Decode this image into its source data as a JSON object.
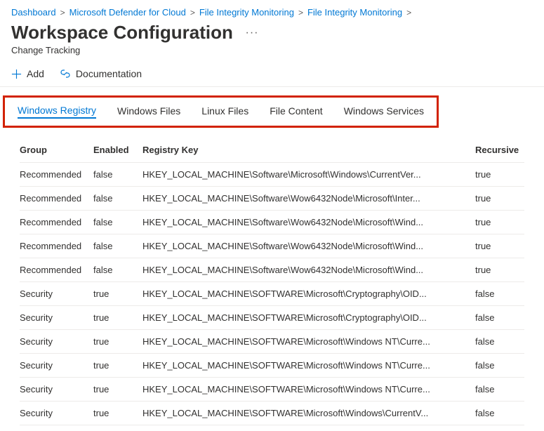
{
  "breadcrumb": {
    "items": [
      "Dashboard",
      "Microsoft Defender for Cloud",
      "File Integrity Monitoring",
      "File Integrity Monitoring"
    ]
  },
  "header": {
    "title": "Workspace Configuration",
    "more": "···",
    "subtitle": "Change Tracking"
  },
  "toolbar": {
    "add": "Add",
    "documentation": "Documentation"
  },
  "tabs": {
    "items": [
      {
        "label": "Windows Registry",
        "active": true
      },
      {
        "label": "Windows Files",
        "active": false
      },
      {
        "label": "Linux Files",
        "active": false
      },
      {
        "label": "File Content",
        "active": false
      },
      {
        "label": "Windows Services",
        "active": false
      }
    ]
  },
  "table": {
    "headers": {
      "group": "Group",
      "enabled": "Enabled",
      "key": "Registry Key",
      "recursive": "Recursive"
    },
    "rows": [
      {
        "group": "Recommended",
        "enabled": "false",
        "key": "HKEY_LOCAL_MACHINE\\Software\\Microsoft\\Windows\\CurrentVer...",
        "recursive": "true"
      },
      {
        "group": "Recommended",
        "enabled": "false",
        "key": "HKEY_LOCAL_MACHINE\\Software\\Wow6432Node\\Microsoft\\Inter...",
        "recursive": "true"
      },
      {
        "group": "Recommended",
        "enabled": "false",
        "key": "HKEY_LOCAL_MACHINE\\Software\\Wow6432Node\\Microsoft\\Wind...",
        "recursive": "true"
      },
      {
        "group": "Recommended",
        "enabled": "false",
        "key": "HKEY_LOCAL_MACHINE\\Software\\Wow6432Node\\Microsoft\\Wind...",
        "recursive": "true"
      },
      {
        "group": "Recommended",
        "enabled": "false",
        "key": "HKEY_LOCAL_MACHINE\\Software\\Wow6432Node\\Microsoft\\Wind...",
        "recursive": "true"
      },
      {
        "group": "Security",
        "enabled": "true",
        "key": "HKEY_LOCAL_MACHINE\\SOFTWARE\\Microsoft\\Cryptography\\OID...",
        "recursive": "false"
      },
      {
        "group": "Security",
        "enabled": "true",
        "key": "HKEY_LOCAL_MACHINE\\SOFTWARE\\Microsoft\\Cryptography\\OID...",
        "recursive": "false"
      },
      {
        "group": "Security",
        "enabled": "true",
        "key": "HKEY_LOCAL_MACHINE\\SOFTWARE\\Microsoft\\Windows NT\\Curre...",
        "recursive": "false"
      },
      {
        "group": "Security",
        "enabled": "true",
        "key": "HKEY_LOCAL_MACHINE\\SOFTWARE\\Microsoft\\Windows NT\\Curre...",
        "recursive": "false"
      },
      {
        "group": "Security",
        "enabled": "true",
        "key": "HKEY_LOCAL_MACHINE\\SOFTWARE\\Microsoft\\Windows NT\\Curre...",
        "recursive": "false"
      },
      {
        "group": "Security",
        "enabled": "true",
        "key": "HKEY_LOCAL_MACHINE\\SOFTWARE\\Microsoft\\Windows\\CurrentV...",
        "recursive": "false"
      }
    ]
  }
}
